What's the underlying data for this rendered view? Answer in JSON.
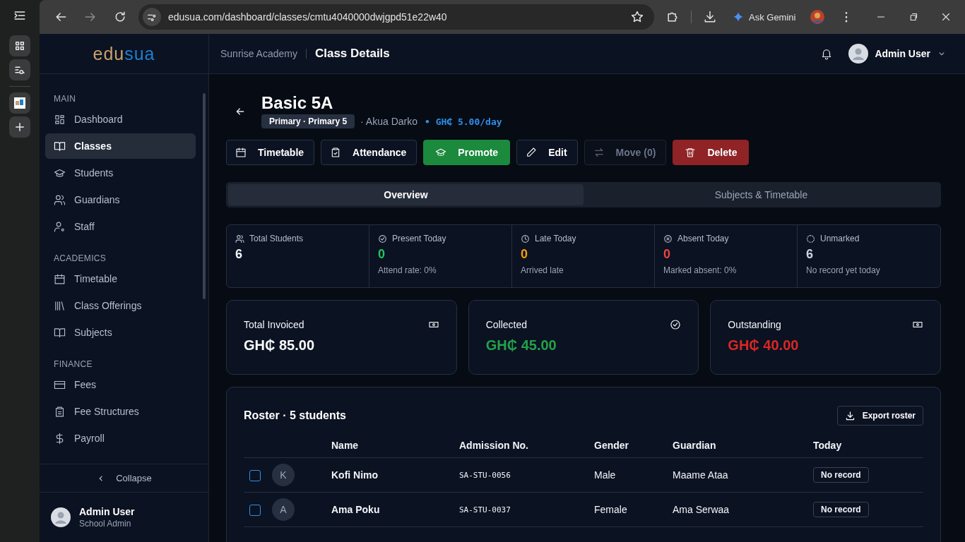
{
  "browser": {
    "url": "edusua.com/dashboard/classes/cmtu4040000dwjgpd51e22w40",
    "ask_label": "Ask Gemini"
  },
  "sidebar": {
    "logo": {
      "part_1": "edu",
      "part_2": "sua"
    },
    "sections": [
      {
        "title": "MAIN",
        "items": [
          {
            "label": "Dashboard",
            "selected": false
          },
          {
            "label": "Classes",
            "selected": true
          },
          {
            "label": "Students",
            "selected": false
          },
          {
            "label": "Guardians",
            "selected": false
          },
          {
            "label": "Staff",
            "selected": false
          }
        ]
      },
      {
        "title": "ACADEMICS",
        "items": [
          {
            "label": "Timetable",
            "selected": false
          },
          {
            "label": "Class Offerings",
            "selected": false
          },
          {
            "label": "Subjects",
            "selected": false
          }
        ]
      },
      {
        "title": "FINANCE",
        "items": [
          {
            "label": "Fees",
            "selected": false
          },
          {
            "label": "Fee Structures",
            "selected": false
          },
          {
            "label": "Payroll",
            "selected": false
          }
        ]
      }
    ],
    "collapse_label": "Collapse",
    "user": {
      "name": "Admin User",
      "role": "School Admin"
    }
  },
  "header": {
    "org": "Sunrise Academy",
    "page_title": "Class Details",
    "user_name": "Admin User"
  },
  "class": {
    "title": "Basic 5A",
    "badge": "Primary · Primary 5",
    "teacher": "· Akua Darko",
    "fee": "• GH₵ 5.00/day"
  },
  "actions": [
    {
      "label": "Timetable",
      "kind": "outline",
      "disabled": false
    },
    {
      "label": "Attendance",
      "kind": "outline",
      "disabled": false
    },
    {
      "label": "Promote",
      "kind": "success",
      "disabled": false
    },
    {
      "label": "Edit",
      "kind": "outline",
      "disabled": false
    },
    {
      "label": "Move (0)",
      "kind": "outline",
      "disabled": true
    },
    {
      "label": "Delete",
      "kind": "danger",
      "disabled": false
    }
  ],
  "tabs": [
    {
      "label": "Overview",
      "selected": true
    },
    {
      "label": "Subjects & Timetable",
      "selected": false
    }
  ],
  "stats": [
    {
      "kind": "total",
      "label": "Total Students",
      "value": "6"
    },
    {
      "kind": "present",
      "label": "Present Today",
      "value": "0",
      "note": "Attend rate: 0%"
    },
    {
      "kind": "late",
      "label": "Late Today",
      "value": "0",
      "note": "Arrived late"
    },
    {
      "kind": "absent",
      "label": "Absent Today",
      "value": "0",
      "note": "Marked absent: 0%"
    },
    {
      "kind": "unmarked",
      "label": "Unmarked",
      "value": "6",
      "note": "No record yet today"
    }
  ],
  "finance": [
    {
      "kind": "invoiced",
      "label": "Total Invoiced",
      "amount": "GH₵ 85.00"
    },
    {
      "kind": "collected",
      "label": "Collected",
      "amount": "GH₵ 45.00"
    },
    {
      "kind": "outstanding",
      "label": "Outstanding",
      "amount": "GH₵ 40.00"
    }
  ],
  "roster": {
    "title": "Roster · 5 students",
    "export_label": "Export roster",
    "columns": [
      "Name",
      "Admission No.",
      "Gender",
      "Guardian",
      "Today"
    ],
    "rows": [
      {
        "checked": false,
        "initial": "K",
        "name": "Kofi Nimo",
        "admission": "SA-STU-0056",
        "gender": "Male",
        "guardian": "Maame Ataa",
        "today": "No record"
      },
      {
        "checked": false,
        "initial": "A",
        "name": "Ama Poku",
        "admission": "SA-STU-0037",
        "gender": "Female",
        "guardian": "Ama Serwaa",
        "today": "No record"
      }
    ]
  }
}
